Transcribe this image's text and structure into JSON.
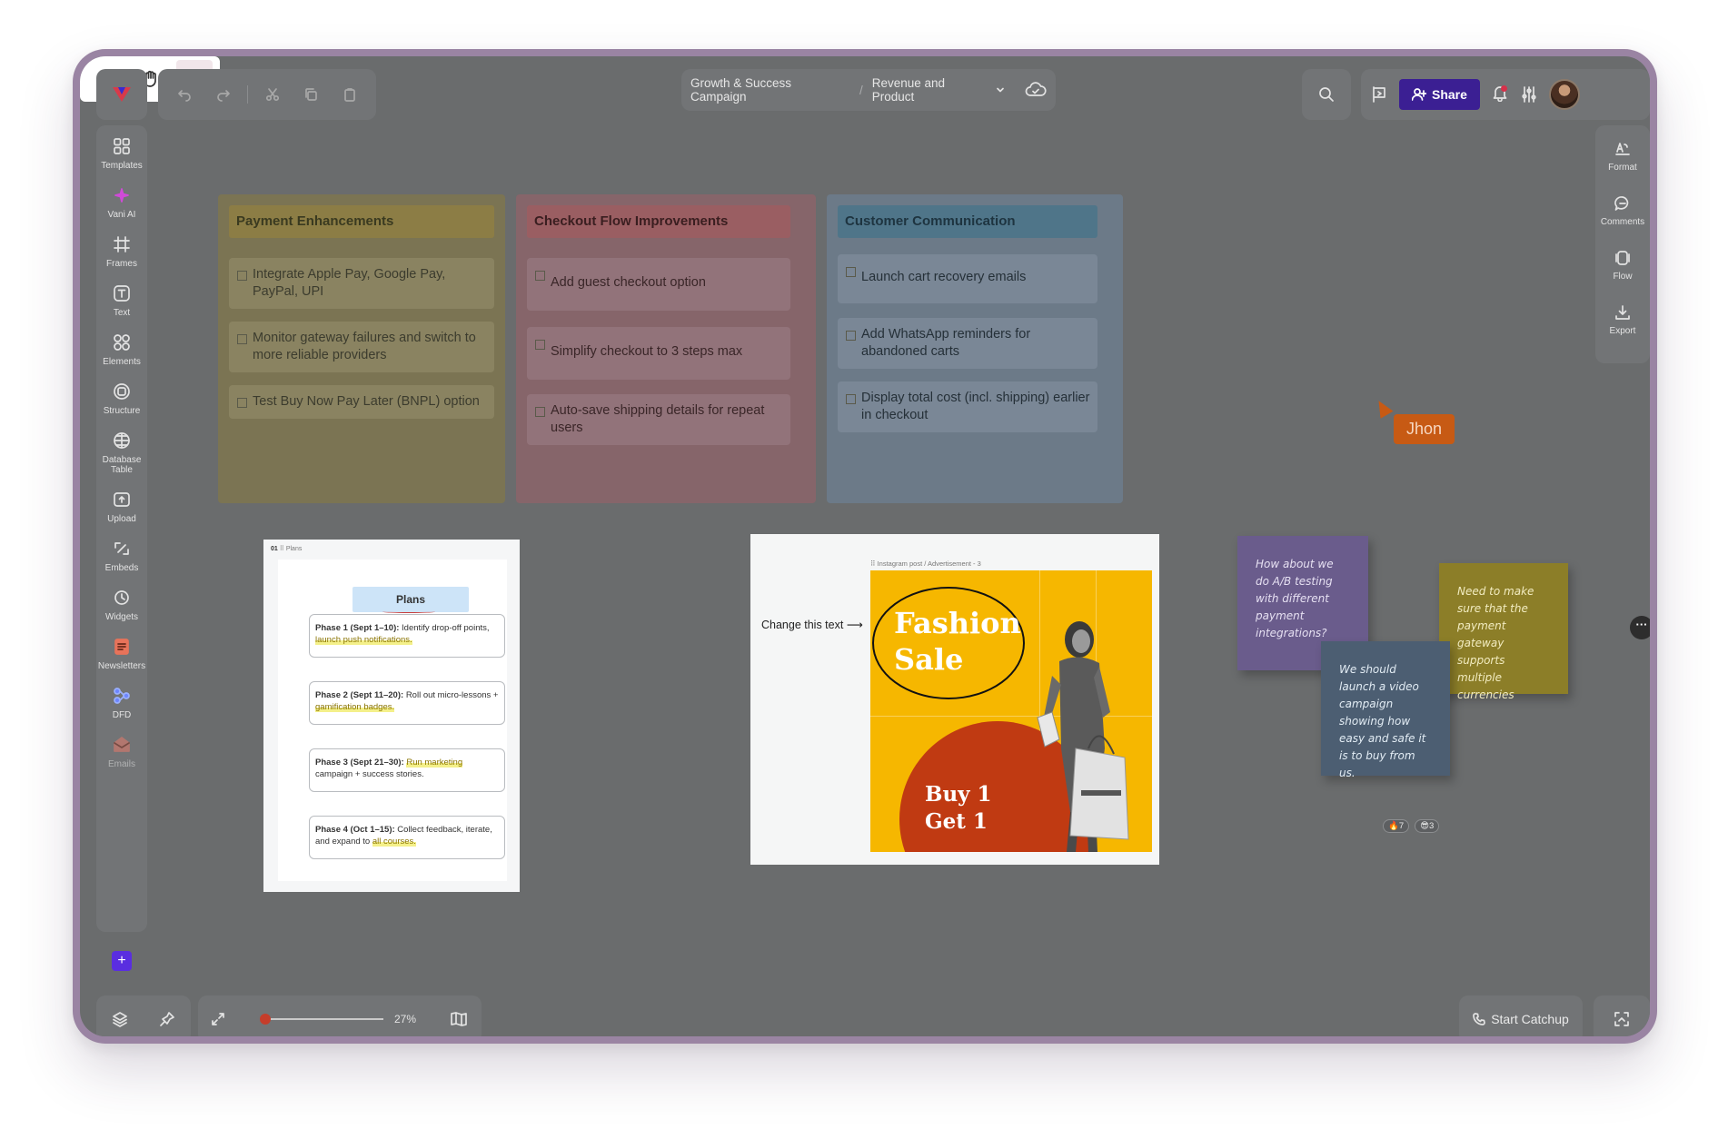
{
  "topbar": {
    "breadcrumb_project": "Growth & Success Campaign",
    "breadcrumb_separator": "/",
    "breadcrumb_page": "Revenue and Product",
    "share_label": "Share"
  },
  "sidebar": {
    "items": [
      {
        "label": "Templates",
        "icon": "templates-icon"
      },
      {
        "label": "Vani AI",
        "icon": "sparkle-icon"
      },
      {
        "label": "Frames",
        "icon": "frame-icon"
      },
      {
        "label": "Text",
        "icon": "text-icon"
      },
      {
        "label": "Elements",
        "icon": "shapes-icon"
      },
      {
        "label": "Structure",
        "icon": "structure-icon"
      },
      {
        "label": "Database Table",
        "icon": "database-icon"
      },
      {
        "label": "Upload",
        "icon": "upload-icon"
      },
      {
        "label": "Embeds",
        "icon": "embed-icon"
      },
      {
        "label": "Widgets",
        "icon": "widget-icon"
      },
      {
        "label": "Newsletters",
        "icon": "newsletter-icon"
      },
      {
        "label": "DFD",
        "icon": "dfd-icon"
      },
      {
        "label": "Emails",
        "icon": "email-icon"
      }
    ]
  },
  "rightbar": {
    "items": [
      {
        "label": "Format",
        "icon": "format-icon"
      },
      {
        "label": "Comments",
        "icon": "comment-icon"
      },
      {
        "label": "Flow",
        "icon": "flow-icon"
      },
      {
        "label": "Export",
        "icon": "export-icon"
      }
    ]
  },
  "bottom": {
    "zoom_label": "27%",
    "zoom_fraction": 0.0,
    "catchup_label": "Start Catchup"
  },
  "board": {
    "columns": [
      {
        "title": "Payment Enhancements",
        "cards": [
          "Integrate Apple Pay, Google Pay, PayPal, UPI",
          "Monitor gateway failures and switch to more reliable providers",
          "Test Buy Now Pay Later (BNPL) option"
        ]
      },
      {
        "title": "Checkout Flow Improvements",
        "cards": [
          "Add guest checkout option",
          "Simplify checkout to 3 steps max",
          "Auto-save shipping details for repeat users"
        ]
      },
      {
        "title": "Customer Communication",
        "cards": [
          "Launch cart recovery emails",
          "Add WhatsApp reminders for abandoned carts",
          "Display total cost (incl. shipping) earlier in checkout"
        ]
      }
    ]
  },
  "plans": {
    "frame_index": "01",
    "frame_tag": "⠿ Plans",
    "title": "Plans",
    "phases": [
      {
        "label": "Phase 1 (Sept 1–10):",
        "text": "Identify drop-off points,",
        "highlight": "launch push notifications."
      },
      {
        "label": "Phase 2 (Sept 11–20):",
        "text": "Roll out micro-lessons +",
        "highlight": "gamification badges."
      },
      {
        "label": "Phase 3 (Sept 21–30):",
        "highlight_inline": "Run marketing",
        "text": "campaign + success stories."
      },
      {
        "label": "Phase 4 (Oct 1–15):",
        "text": "Collect feedback, iterate, and expand to",
        "highlight": "all courses."
      }
    ]
  },
  "instagram": {
    "frame_tag": "⠿ Instagram post / Advertisement - 3",
    "annotation": "Change this text ⟶",
    "headline_1": "Fashion",
    "headline_2": "Sale",
    "offer_1": "Buy 1",
    "offer_2": "Get 1"
  },
  "stickies": [
    {
      "text": "How about we do A/B testing with different payment integrations?",
      "color": "#6a5c8c"
    },
    {
      "text": "We should launch a video campaign showing how easy and safe it is to buy from us.",
      "color": "#4c5e72"
    },
    {
      "text": "Need to make sure that the payment gateway supports multiple currencies",
      "color": "#8c7e28"
    }
  ],
  "reactions": [
    {
      "emoji": "🔥",
      "count": "7"
    },
    {
      "emoji": "😎",
      "count": "3"
    }
  ],
  "cursor": {
    "name": "Jhon",
    "color": "#c75a14"
  },
  "colors": {
    "canvas": "#6a6c6d",
    "panel": "#727476",
    "share": "#3b1f93",
    "col_payment_bg": "#7b7453",
    "col_payment_head": "#8c7d45",
    "col_checkout_bg": "#86656a",
    "col_checkout_head": "#9a5e62",
    "col_comm_bg": "#6c7a88",
    "col_comm_head": "#4f7589"
  }
}
